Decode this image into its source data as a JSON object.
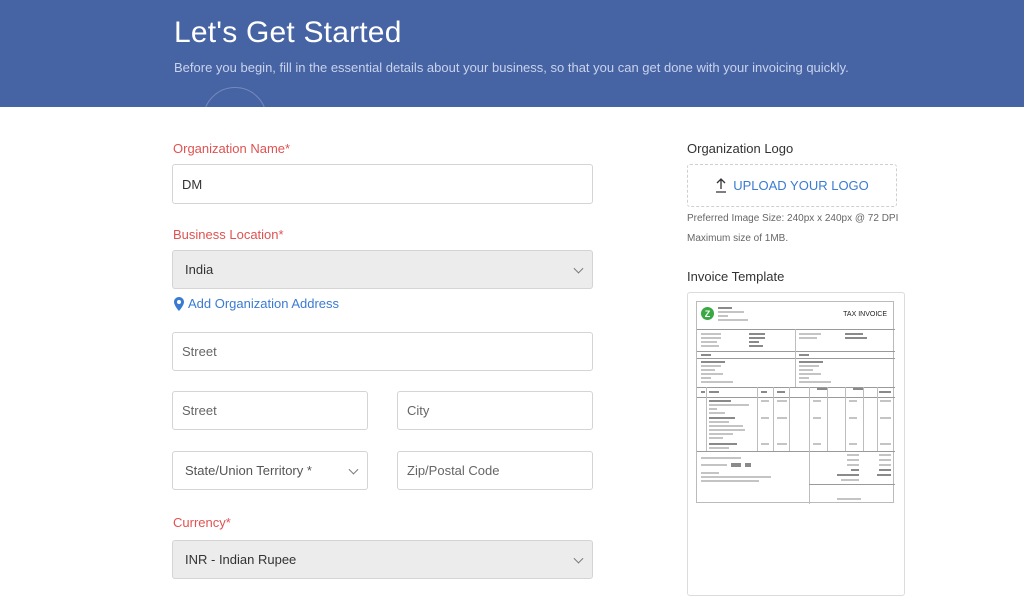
{
  "header": {
    "title": "Let's Get Started",
    "subtitle": "Before you begin, fill in the essential details about your business, so that you can get done with your invoicing quickly."
  },
  "form": {
    "org_name_label": "Organization Name*",
    "org_name_value": "DM",
    "business_location_label": "Business Location*",
    "business_location_value": "India",
    "add_address_link": "Add Organization Address",
    "street1_placeholder": "Street",
    "street2_placeholder": "Street",
    "city_placeholder": "City",
    "state_placeholder": "State/Union Territory *",
    "zip_placeholder": "Zip/Postal Code",
    "currency_label": "Currency*",
    "currency_value": "INR - Indian Rupee"
  },
  "logo": {
    "label": "Organization Logo",
    "upload_button": "UPLOAD YOUR LOGO",
    "hint_size": "Preferred Image Size: 240px x 240px @ 72 DPI",
    "hint_max": "Maximum size of 1MB."
  },
  "template": {
    "label": "Invoice Template",
    "preview_title": "TAX INVOICE",
    "preview_logo_letter": "Z"
  },
  "colors": {
    "header_bg": "#4663a4",
    "required_label": "#e05252",
    "link": "#3b7ad3"
  }
}
